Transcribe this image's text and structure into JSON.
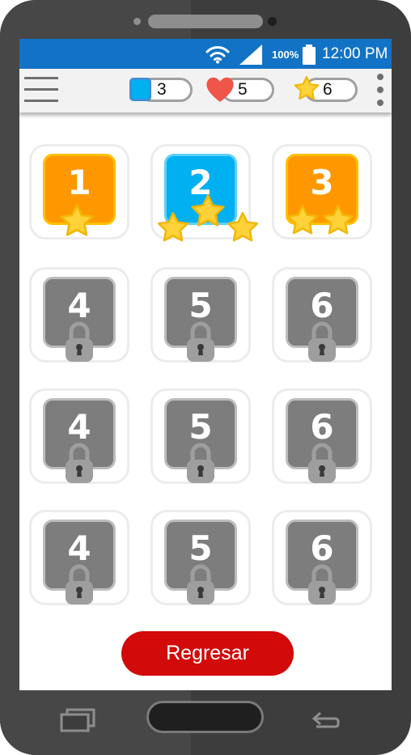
{
  "status_bar": {
    "battery_percent": "100%",
    "time": "12:00 PM",
    "wifi_icon": "wifi-icon",
    "signal_icon": "signal-icon",
    "battery_icon": "battery-icon"
  },
  "app_bar": {
    "menu_icon": "hamburger-icon",
    "more_icon": "more-vertical-icon",
    "counters": [
      {
        "name": "gems",
        "icon": "blue-square-icon",
        "value": "3"
      },
      {
        "name": "lives",
        "icon": "heart-icon",
        "value": "5"
      },
      {
        "name": "stars",
        "icon": "star-icon",
        "value": "6"
      }
    ]
  },
  "levels": [
    {
      "number": "1",
      "state": "unlocked",
      "color": "#ff9800",
      "stars": 1
    },
    {
      "number": "2",
      "state": "unlocked",
      "color": "#00b0f0",
      "stars": 3
    },
    {
      "number": "3",
      "state": "unlocked",
      "color": "#ff9800",
      "stars": 2
    },
    {
      "number": "4",
      "state": "locked"
    },
    {
      "number": "5",
      "state": "locked"
    },
    {
      "number": "6",
      "state": "locked"
    },
    {
      "number": "4",
      "state": "locked"
    },
    {
      "number": "5",
      "state": "locked"
    },
    {
      "number": "6",
      "state": "locked"
    },
    {
      "number": "4",
      "state": "locked"
    },
    {
      "number": "5",
      "state": "locked"
    },
    {
      "number": "6",
      "state": "locked"
    }
  ],
  "back_button": {
    "label": "Regresar"
  },
  "colors": {
    "status_bar": "#1273c6",
    "orange": "#ff9800",
    "blue": "#00b0f0",
    "locked": "#7d7d7d",
    "star": "#ffd23a",
    "heart": "#f0554a",
    "button": "#d20a0a"
  },
  "nav_bar": {
    "recents_icon": "recents-icon",
    "home_icon": "home-button",
    "back_icon": "back-arrow-icon"
  }
}
